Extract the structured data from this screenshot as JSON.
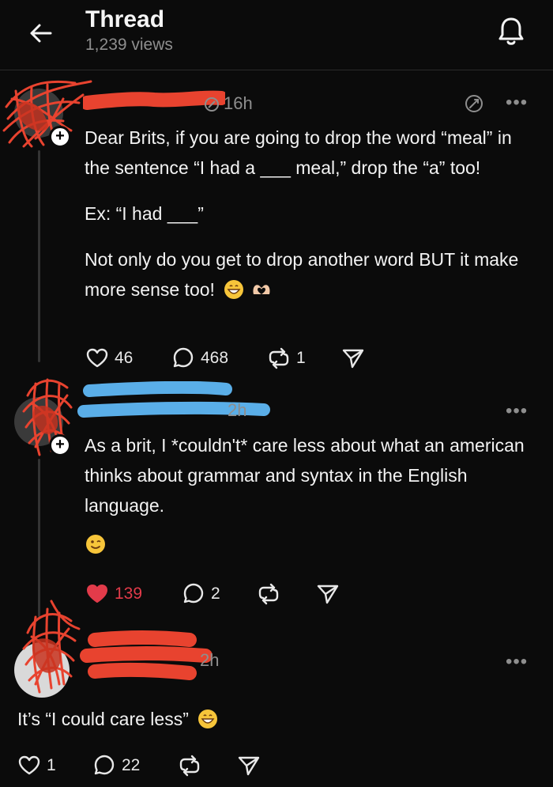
{
  "header": {
    "title": "Thread",
    "views": "1,239 views"
  },
  "posts": [
    {
      "username": "",
      "time": "16h",
      "paragraphs": [
        "Dear Brits, if you are going to drop the word “meal” in the sentence “I had a ___ meal,” drop the “a” too!",
        "Ex: “I had ___”",
        "Not only do you get to drop another word BUT it make more sense too!"
      ],
      "emojis": [
        "grinning-face",
        "heart-hands"
      ],
      "likes": "46",
      "comments": "468",
      "reposts": "1",
      "liked": false
    },
    {
      "username": "",
      "time": "2h",
      "paragraphs": [
        "As a brit, I *couldn't* care less about what an american thinks about grammar and syntax in the English language."
      ],
      "emojis": [
        "winking-face"
      ],
      "likes": "139",
      "comments": "2",
      "reposts": "",
      "liked": true
    },
    {
      "username": "",
      "time": "2h",
      "paragraphs": [
        "It’s “I could care less”"
      ],
      "emojis": [
        "grinning-face"
      ],
      "likes": "1",
      "comments": "22",
      "reposts": "",
      "liked": false
    }
  ],
  "colors": {
    "background": "#0b0b0b",
    "secondary_text": "#8e8e8e",
    "like_red": "#e23b4a",
    "redaction_red": "#e8432f",
    "redaction_blue": "#5aaee8"
  }
}
